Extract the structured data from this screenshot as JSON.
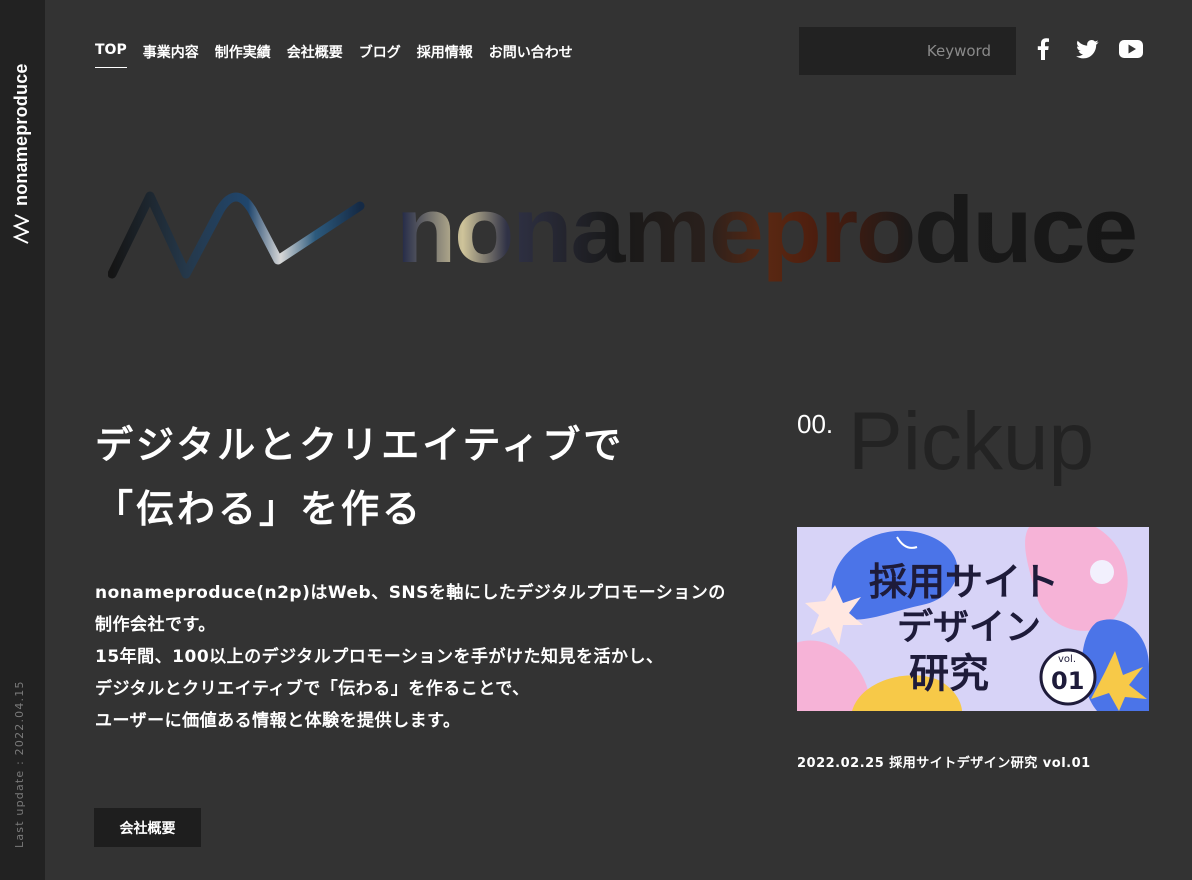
{
  "sidebar": {
    "brand": "nonameproduce",
    "last_update": "Last update : 2022.04.15"
  },
  "nav": [
    {
      "label": "TOP",
      "active": true
    },
    {
      "label": "事業内容"
    },
    {
      "label": "制作実績"
    },
    {
      "label": "会社概要"
    },
    {
      "label": "ブログ"
    },
    {
      "label": "採用情報"
    },
    {
      "label": "お問い合わせ"
    }
  ],
  "search": {
    "placeholder": "Keyword"
  },
  "social": [
    "facebook-icon",
    "twitter-icon",
    "youtube-icon"
  ],
  "hero": {
    "logo_text": "nonameproduce",
    "title_line1": "デジタルとクリエイティブで",
    "title_line2": "「伝わる」を作る",
    "desc_lines": [
      "nonameproduce(n2p)はWeb、SNSを軸にしたデジタルプロモーションの",
      "制作会社です。",
      "15年間、100以上のデジタルプロモーションを手がけた知見を活かし、",
      "デジタルとクリエイティブで「伝わる」を作ることで、",
      "ユーザーに価値ある情報と体験を提供します。"
    ],
    "button_label": "会社概要"
  },
  "pickup": {
    "number": "00.",
    "title": "Pickup",
    "card": {
      "line1": "採用サイト",
      "line2": "デザイン",
      "line3": "研究",
      "vol_label": "vol.",
      "vol_number": "01"
    },
    "caption": "2022.02.25 採用サイトデザイン研究 vol.01"
  },
  "colors": {
    "background": "#333333",
    "sidebar": "#222222",
    "search_bg": "#222222",
    "card_bg": "#d7d3f7"
  }
}
